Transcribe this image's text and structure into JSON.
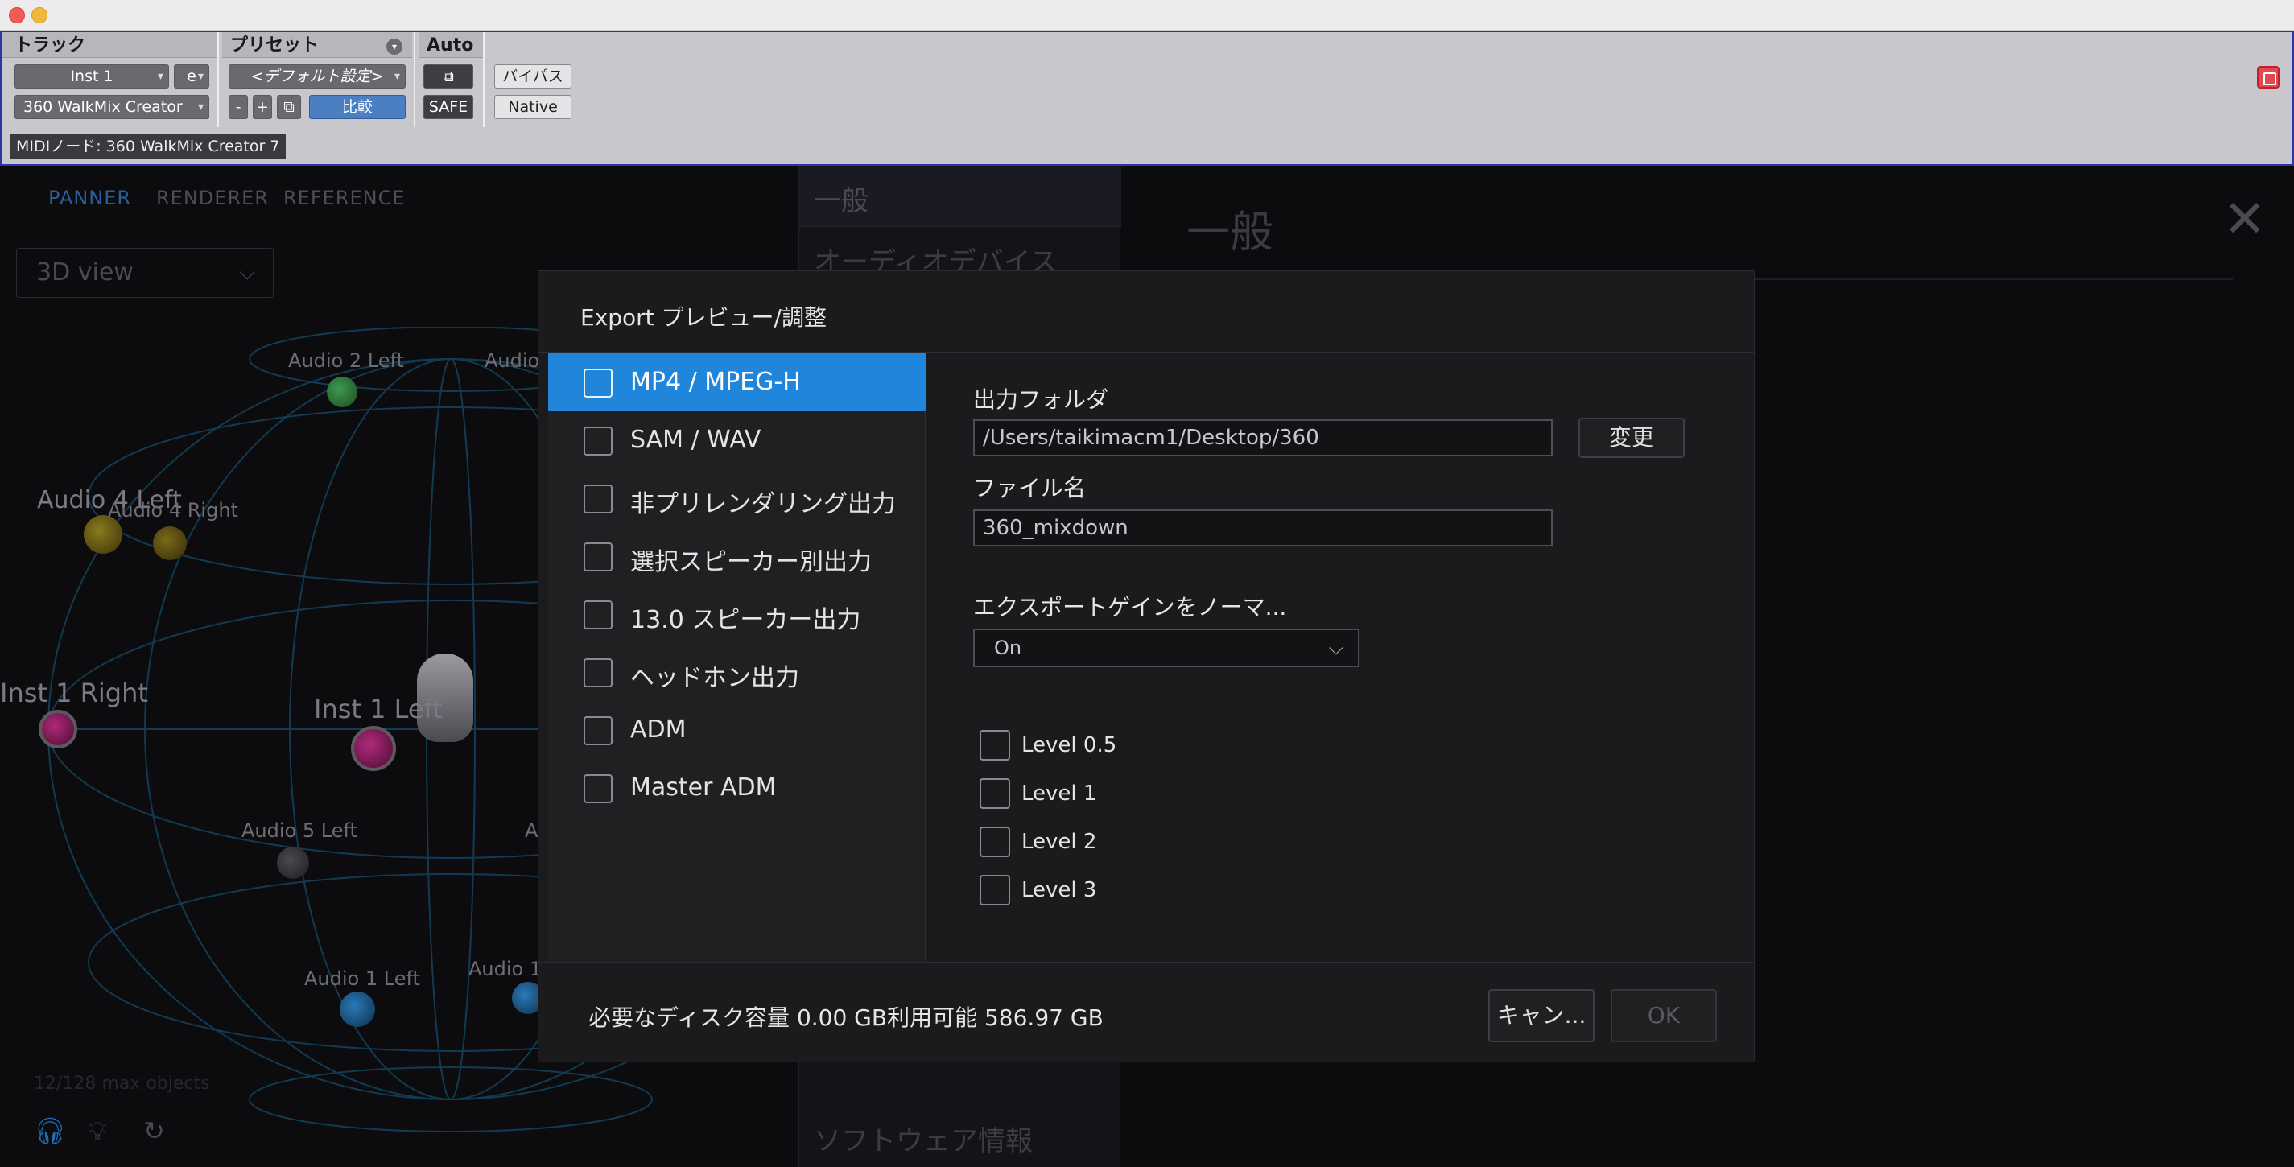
{
  "plugin_header": {
    "track_title": "トラック",
    "preset_title": "プリセット",
    "auto_title": "Auto",
    "track_name": "Inst 1",
    "track_letter": "e",
    "plugin_name": "360 WalkMix Creator",
    "preset_name": "<デフォルト設定>",
    "minus": "-",
    "plus": "+",
    "compare": "比較",
    "safe": "SAFE",
    "bypass": "バイパス",
    "native": "Native",
    "midi_node": "MIDIノード: 360 WalkMix Creator 7"
  },
  "app": {
    "tabs": [
      "PANNER",
      "RENDERER",
      "REFERENCE"
    ],
    "view_select": "3D view",
    "settings_items": [
      "一般",
      "オーディオデバイス",
      "ソフトウェア情報"
    ],
    "right_title": "一般",
    "max_objects": "12/128 max objects",
    "objects": [
      {
        "label": "Audio 2 Left"
      },
      {
        "label": "Audio"
      },
      {
        "label": "Audio 4 Left"
      },
      {
        "label": "Audio 4 Right"
      },
      {
        "label": "Inst 1 Right"
      },
      {
        "label": "Inst 1 Left"
      },
      {
        "label": "Audio 5 Left"
      },
      {
        "label": "A"
      },
      {
        "label": "Audio 1 Left"
      },
      {
        "label": "Audio 1"
      }
    ],
    "accent_color": "#1f86dc"
  },
  "dialog": {
    "title": "Export プレビュー/調整",
    "formats": [
      {
        "label": "MP4 / MPEG-H",
        "selected": true
      },
      {
        "label": "SAM / WAV",
        "selected": false
      },
      {
        "label": "非プリレンダリング出力",
        "selected": false
      },
      {
        "label": "選択スピーカー別出力",
        "selected": false
      },
      {
        "label": "13.0 スピーカー出力",
        "selected": false
      },
      {
        "label": "ヘッドホン出力",
        "selected": false
      },
      {
        "label": "ADM",
        "selected": false
      },
      {
        "label": "Master ADM",
        "selected": false
      }
    ],
    "output_folder_label": "出力フォルダ",
    "output_folder_value": "/Users/taikimacm1/Desktop/360",
    "change_button": "変更",
    "file_name_label": "ファイル名",
    "file_name_value": "360_mixdown",
    "normalize_label": "エクスポートゲインをノーマ...",
    "normalize_value": "On",
    "levels": [
      "Level 0.5",
      "Level 1",
      "Level 2",
      "Level 3"
    ],
    "disk_info": "必要なディスク容量 0.00 GB利用可能 586.97 GB",
    "cancel_button": "キャン...",
    "ok_button": "OK"
  }
}
